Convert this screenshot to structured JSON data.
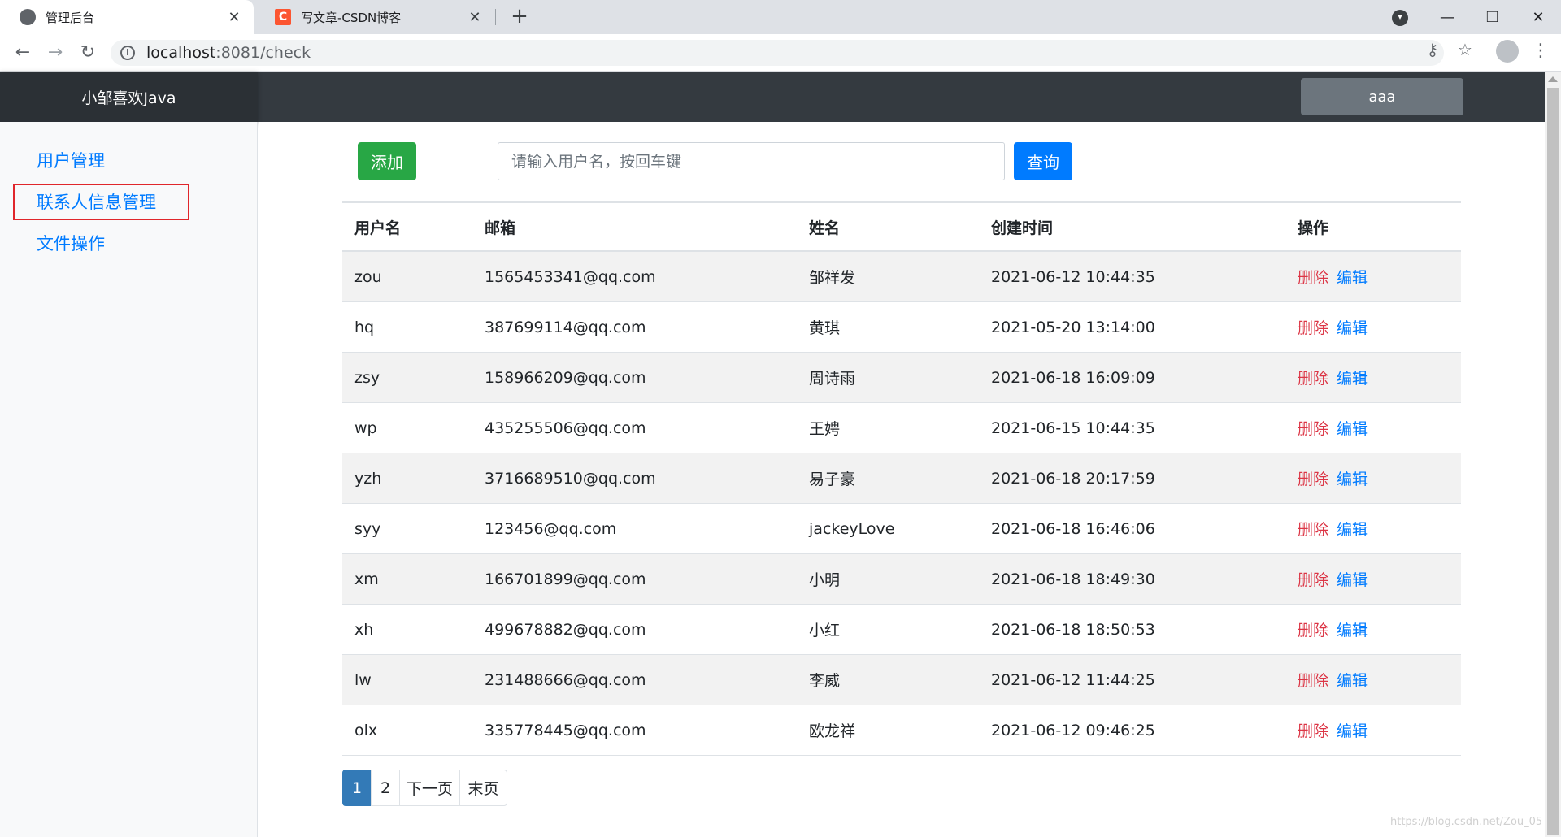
{
  "browser": {
    "tabs": [
      {
        "title": "管理后台",
        "close": "✕"
      },
      {
        "title": "写文章-CSDN博客",
        "close": "✕",
        "favicon_letter": "C"
      }
    ],
    "new_tab": "+",
    "url_host": "localhost",
    "url_rest": ":8081/check",
    "window_controls": [
      "—",
      "❐",
      "✕"
    ]
  },
  "app": {
    "brand": "小邹喜欢Java",
    "user_button": "aaa"
  },
  "sidebar": {
    "items": [
      {
        "label": "用户管理"
      },
      {
        "label": "联系人信息管理"
      },
      {
        "label": "文件操作"
      }
    ]
  },
  "toolbar": {
    "add_label": "添加",
    "search_placeholder": "请输入用户名，按回车键",
    "query_label": "查询"
  },
  "table": {
    "headers": [
      "用户名",
      "邮箱",
      "姓名",
      "创建时间",
      "操作"
    ],
    "rows": [
      {
        "username": "zou",
        "email": "1565453341@qq.com",
        "name": "邹祥发",
        "created": "2021-06-12 10:44:35"
      },
      {
        "username": "hq",
        "email": "387699114@qq.com",
        "name": "黄琪",
        "created": "2021-05-20 13:14:00"
      },
      {
        "username": "zsy",
        "email": "158966209@qq.com",
        "name": "周诗雨",
        "created": "2021-06-18 16:09:09"
      },
      {
        "username": "wp",
        "email": "435255506@qq.com",
        "name": "王娉",
        "created": "2021-06-15 10:44:35"
      },
      {
        "username": "yzh",
        "email": "3716689510@qq.com",
        "name": "易子豪",
        "created": "2021-06-18 20:17:59"
      },
      {
        "username": "syy",
        "email": "123456@qq.com",
        "name": "jackeyLove",
        "created": "2021-06-18 16:46:06"
      },
      {
        "username": "xm",
        "email": "166701899@qq.com",
        "name": "小明",
        "created": "2021-06-18 18:49:30"
      },
      {
        "username": "xh",
        "email": "499678882@qq.com",
        "name": "小红",
        "created": "2021-06-18 18:50:53"
      },
      {
        "username": "lw",
        "email": "231488666@qq.com",
        "name": "李威",
        "created": "2021-06-12 11:44:25"
      },
      {
        "username": "olx",
        "email": "335778445@qq.com",
        "name": "欧龙祥",
        "created": "2021-06-12 09:46:25"
      }
    ],
    "delete_label": "删除",
    "edit_label": "编辑"
  },
  "pagination": {
    "pages": [
      "1",
      "2"
    ],
    "next_label": "下一页",
    "last_label": "末页"
  },
  "watermark": "https://blog.csdn.net/Zou_05"
}
